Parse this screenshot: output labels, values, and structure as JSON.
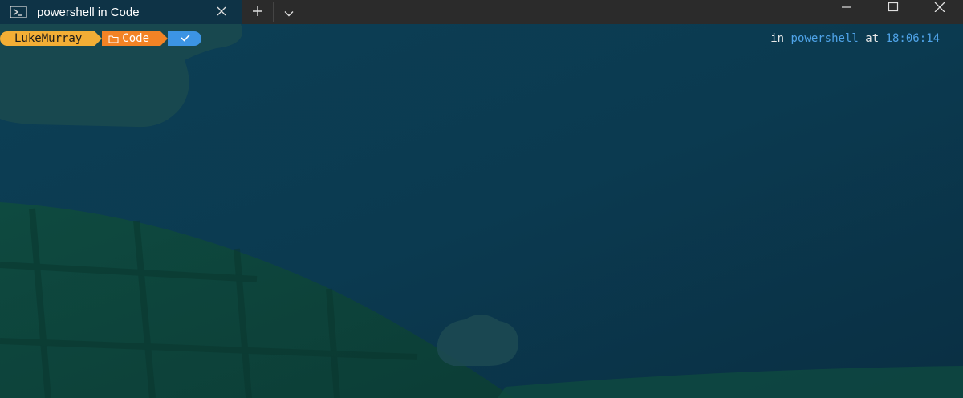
{
  "titlebar": {
    "tab_title": "powershell in Code",
    "tab_icon": "powershell-icon",
    "new_tab_icon": "plus-icon",
    "dropdown_icon": "chevron-down-icon",
    "window_controls": [
      "minimize-icon",
      "maximize-icon",
      "close-icon"
    ]
  },
  "prompt": {
    "user": "LukeMurray",
    "path_icon": "folder-icon",
    "path": "Code",
    "status_icon": "check-icon"
  },
  "right_prompt": {
    "in_word": "in",
    "shell": "powershell",
    "at_word": "at",
    "time": "18:06:14"
  },
  "colors": {
    "user_segment": "#f3ae35",
    "path_segment": "#f28325",
    "status_segment": "#3c94e4",
    "background": "#0d3a4f",
    "accent_text": "#4fa3e8"
  }
}
